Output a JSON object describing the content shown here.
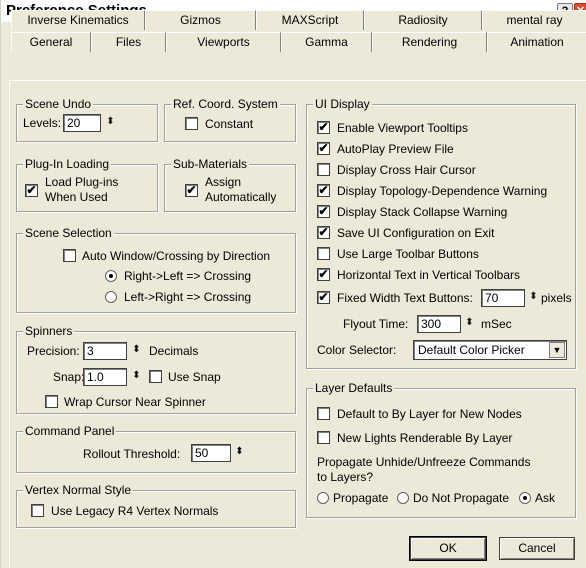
{
  "window": {
    "title": "Preference Settings",
    "help_glyph": "?",
    "close_glyph": "✕"
  },
  "tabs": {
    "row1": [
      "Inverse Kinematics",
      "Gizmos",
      "MAXScript",
      "Radiosity",
      "mental ray"
    ],
    "row2": [
      "General",
      "Files",
      "Viewports",
      "Gamma",
      "Rendering",
      "Animation"
    ],
    "active": "General"
  },
  "scene_undo": {
    "title": "Scene Undo",
    "levels_label": "Levels:",
    "levels_value": "20"
  },
  "ref_coord": {
    "title": "Ref. Coord. System",
    "constant_label": "Constant",
    "constant_checked": false
  },
  "plugin_loading": {
    "title": "Plug-In Loading",
    "load_label_1": "Load Plug-ins",
    "load_label_2": "When Used",
    "load_checked": true
  },
  "sub_materials": {
    "title": "Sub-Materials",
    "assign_label_1": "Assign",
    "assign_label_2": "Automatically",
    "assign_checked": true
  },
  "scene_selection": {
    "title": "Scene Selection",
    "auto_label": "Auto Window/Crossing by Direction",
    "auto_checked": false,
    "right_left_label": "Right->Left => Crossing",
    "right_left_selected": true,
    "left_right_label": "Left->Right => Crossing",
    "left_right_selected": false
  },
  "spinners": {
    "title": "Spinners",
    "precision_label": "Precision:",
    "precision_value": "3",
    "decimals_label": "Decimals",
    "snap_label": "Snap:",
    "snap_value": "1.0",
    "use_snap_label": "Use Snap",
    "use_snap_checked": false,
    "wrap_label": "Wrap Cursor Near Spinner",
    "wrap_checked": false
  },
  "command_panel": {
    "title": "Command Panel",
    "rollout_label": "Rollout Threshold:",
    "rollout_value": "50"
  },
  "vertex_normal": {
    "title": "Vertex Normal Style",
    "legacy_label": "Use Legacy R4 Vertex Normals",
    "legacy_checked": false
  },
  "ui_display": {
    "title": "UI Display",
    "options": [
      {
        "label": "Enable Viewport Tooltips",
        "checked": true
      },
      {
        "label": "AutoPlay Preview File",
        "checked": true
      },
      {
        "label": "Display Cross Hair Cursor",
        "checked": false
      },
      {
        "label": "Display Topology-Dependence Warning",
        "checked": true
      },
      {
        "label": "Display Stack Collapse Warning",
        "checked": true
      },
      {
        "label": "Save UI Configuration on Exit",
        "checked": true
      },
      {
        "label": "Use Large Toolbar Buttons",
        "checked": false
      },
      {
        "label": "Horizontal Text in Vertical Toolbars",
        "checked": true
      }
    ],
    "fixed_width_label": "Fixed Width Text Buttons:",
    "fixed_width_checked": true,
    "fixed_width_value": "70",
    "pixels_label": "pixels",
    "flyout_label": "Flyout Time:",
    "flyout_value": "300",
    "msec_label": "mSec",
    "color_selector_label": "Color Selector:",
    "color_selector_value": "Default Color Picker"
  },
  "layer_defaults": {
    "title": "Layer Defaults",
    "by_layer_label": "Default to By Layer for New Nodes",
    "by_layer_checked": false,
    "new_lights_label": "New Lights Renderable By Layer",
    "new_lights_checked": false,
    "propagate_question_1": "Propagate Unhide/Unfreeze Commands",
    "propagate_question_2": "to Layers?",
    "propagate_label": "Propagate",
    "propagate_selected": false,
    "do_not_propagate_label": "Do Not Propagate",
    "do_not_propagate_selected": false,
    "ask_label": "Ask",
    "ask_selected": true
  },
  "buttons": {
    "ok": "OK",
    "cancel": "Cancel"
  },
  "glyphs": {
    "check": "✔",
    "spin": "⬍",
    "dropdown": "▼"
  }
}
